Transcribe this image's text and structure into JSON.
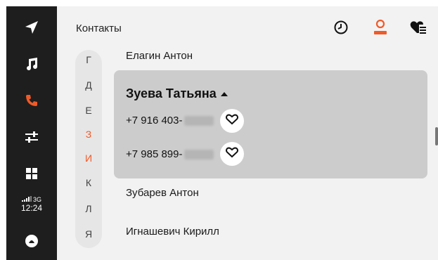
{
  "sidebar": {
    "items": [
      {
        "icon": "navigation-arrow-icon"
      },
      {
        "icon": "music-note-icon"
      },
      {
        "icon": "phone-icon",
        "active_color": "#f05a28"
      },
      {
        "icon": "settings-sliders-icon"
      },
      {
        "icon": "apps-grid-icon"
      }
    ],
    "status": {
      "network": "3G",
      "time": "12:24"
    },
    "bottom_icon": "alice-assistant-icon"
  },
  "header": {
    "title": "Контакты",
    "icons": [
      "history-clock-icon",
      "contacts-person-icon",
      "favorites-list-icon"
    ],
    "accent": "#f05a28"
  },
  "alphabet": {
    "letters": [
      "Г",
      "Д",
      "Е",
      "З",
      "И",
      "К",
      "Л",
      "Я"
    ],
    "active": [
      "З",
      "И"
    ]
  },
  "contacts": {
    "above": "Елагин Антон",
    "expanded": {
      "name": "Зуева Татьяна",
      "phones": [
        "+7 916 403-",
        "+7 985 899-"
      ]
    },
    "below": [
      "Зубарев Антон",
      "Игнашевич Кирилл"
    ]
  }
}
